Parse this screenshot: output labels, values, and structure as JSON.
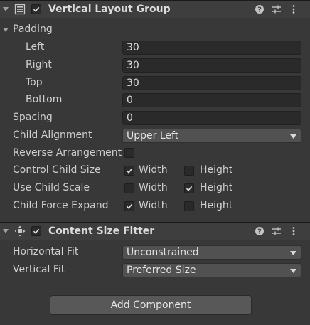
{
  "vertical_layout_group": {
    "title": "Vertical Layout Group",
    "enabled": true,
    "padding": {
      "label": "Padding",
      "left_label": "Left",
      "left_value": "30",
      "right_label": "Right",
      "right_value": "30",
      "top_label": "Top",
      "top_value": "30",
      "bottom_label": "Bottom",
      "bottom_value": "0"
    },
    "spacing_label": "Spacing",
    "spacing_value": "0",
    "child_alignment_label": "Child Alignment",
    "child_alignment_value": "Upper Left",
    "reverse_arrangement_label": "Reverse Arrangement",
    "reverse_arrangement_checked": false,
    "control_child_size": {
      "label": "Control Child Size",
      "width_label": "Width",
      "width_checked": true,
      "height_label": "Height",
      "height_checked": false
    },
    "use_child_scale": {
      "label": "Use Child Scale",
      "width_label": "Width",
      "width_checked": false,
      "height_label": "Height",
      "height_checked": true
    },
    "child_force_expand": {
      "label": "Child Force Expand",
      "width_label": "Width",
      "width_checked": true,
      "height_label": "Height",
      "height_checked": false
    }
  },
  "content_size_fitter": {
    "title": "Content Size Fitter",
    "enabled": true,
    "horizontal_fit_label": "Horizontal Fit",
    "horizontal_fit_value": "Unconstrained",
    "vertical_fit_label": "Vertical Fit",
    "vertical_fit_value": "Preferred Size"
  },
  "add_component_label": "Add Component",
  "icons": [
    "fold-arrow-icon",
    "layout-group-icon",
    "checkmark-icon",
    "help-icon",
    "presets-icon",
    "kebab-menu-icon",
    "content-fitter-icon",
    "dropdown-arrow-icon"
  ],
  "colors": {
    "background": "#383838",
    "header": "#3e3e3e",
    "field": "#2a2a2a",
    "dropdown": "#515151",
    "text": "#d2d2d2"
  }
}
